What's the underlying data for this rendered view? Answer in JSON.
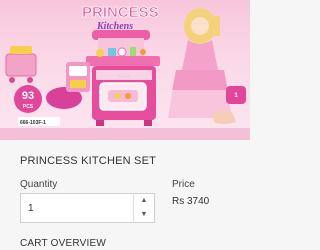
{
  "product": {
    "title": "PRINCESS KITCHEN SET",
    "image": {
      "box_brand_line1": "PRINCESS",
      "box_brand_line2": "Kitchens",
      "box_piece_count": "93",
      "box_piece_unit": "PCS",
      "box_model_code": "666-103F-1",
      "colors": {
        "box_pink": "#e6539a",
        "box_light": "#f9c6dd",
        "toy_pink": "#ec5fa6",
        "accent_yellow": "#f5d247"
      }
    }
  },
  "quantity": {
    "label": "Quantity",
    "value": "1",
    "increment_icon": "chevron-up-icon",
    "decrement_icon": "chevron-down-icon"
  },
  "price": {
    "label": "Price",
    "value": "Rs 3740"
  },
  "cart": {
    "heading": "CART OVERVIEW"
  }
}
